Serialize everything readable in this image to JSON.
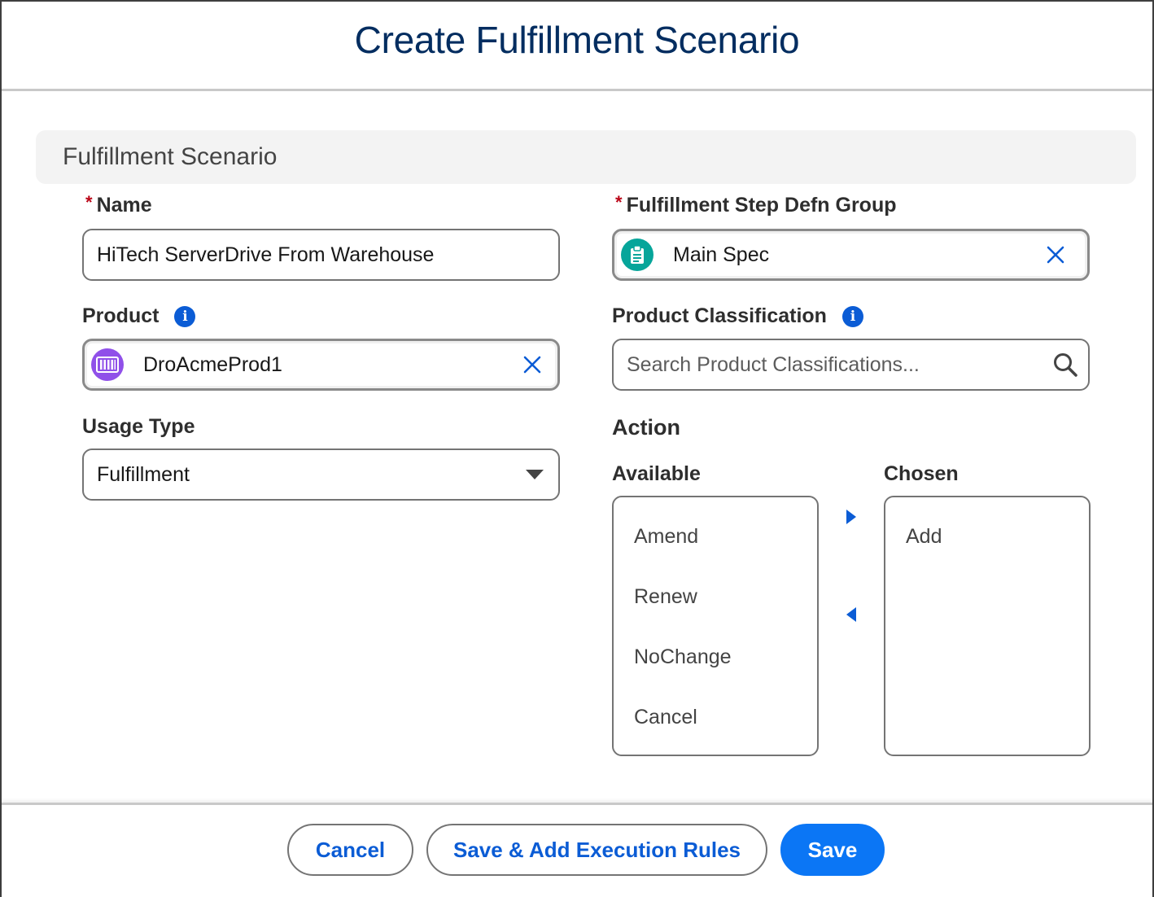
{
  "modal": {
    "title": "Create Fulfillment Scenario"
  },
  "section": {
    "title": "Fulfillment Scenario"
  },
  "fields": {
    "name": {
      "required_marker": "*",
      "label": "Name",
      "value": "HiTech ServerDrive From Warehouse"
    },
    "step_group": {
      "required_marker": "*",
      "label": "Fulfillment Step Defn Group",
      "value": "Main Spec",
      "icon": "clipboard-icon"
    },
    "product": {
      "label": "Product",
      "value": "DroAcmeProd1",
      "icon": "product-icon",
      "info_icon": "i"
    },
    "product_classification": {
      "label": "Product Classification",
      "placeholder": "Search Product Classifications...",
      "info_icon": "i"
    },
    "usage_type": {
      "label": "Usage Type",
      "value": "Fulfillment"
    }
  },
  "action": {
    "label": "Action",
    "available_label": "Available",
    "chosen_label": "Chosen",
    "available": [
      "Amend",
      "Renew",
      "NoChange",
      "Cancel"
    ],
    "chosen": [
      "Add"
    ]
  },
  "footer": {
    "cancel": "Cancel",
    "save_add_rules": "Save & Add Execution Rules",
    "save": "Save"
  },
  "colors": {
    "title": "#032d60",
    "brand": "#0b76f5",
    "link": "#0b5cd5",
    "required": "#ba0517",
    "product_icon_bg": "#9050e9",
    "step_icon_bg": "#06a59a"
  }
}
